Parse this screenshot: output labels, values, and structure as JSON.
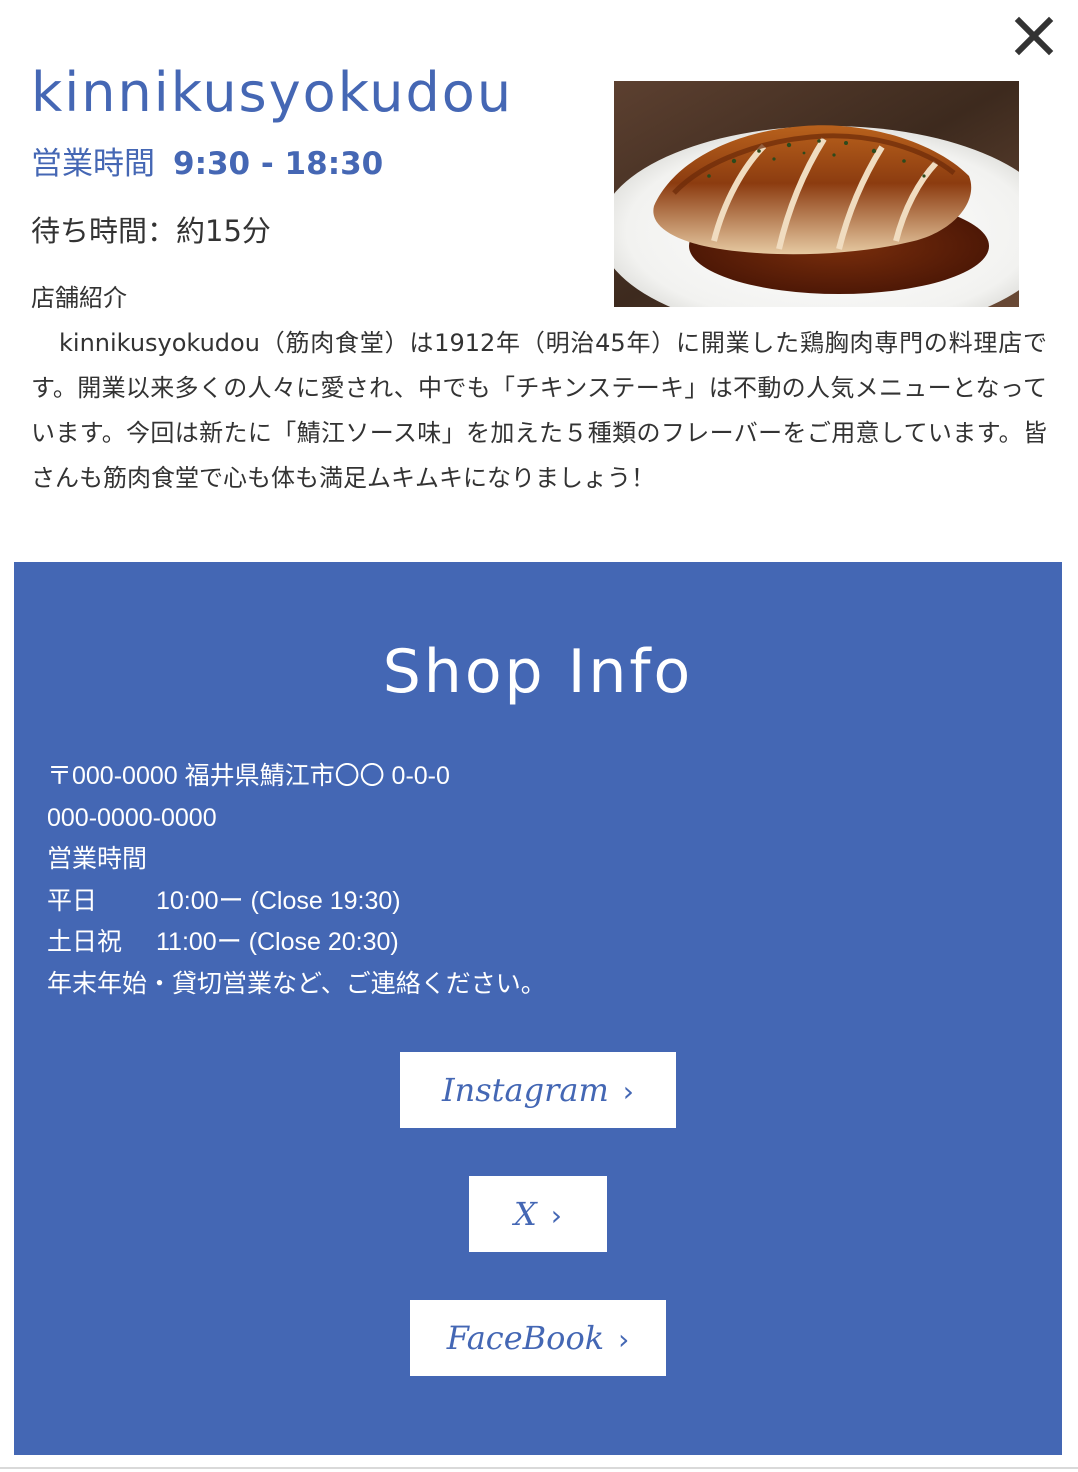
{
  "modal": {
    "close_icon": "close-icon"
  },
  "shop": {
    "name": "kinnikusyokudou",
    "hours_label": "営業時間",
    "hours_value": "9:30 - 18:30",
    "wait_time": "待ち時間：約15分",
    "intro_heading": "店舗紹介",
    "intro_text": "kinnikusyokudou（筋肉食堂）は1912年（明治45年）に開業した鶏胸肉専門の料理店です。開業以来多くの人々に愛され、中でも「チキンステーキ」は不動の人気メニューとなっています。今回は新たに「鯖江ソース味」を加えた５種類のフレーバーをご用意しています。皆さんも筋肉食堂で心も体も満足ムキムキになりましょう！"
  },
  "shop_info": {
    "title": "Shop Info",
    "address": "〒000-0000 福井県鯖江市〇〇 0-0-0",
    "phone": "000-0000-0000",
    "hours_heading": "営業時間",
    "weekday_label": "平日",
    "weekday_hours": "10:00ー  (Close 19:30)",
    "holiday_label": "土日祝",
    "holiday_hours": "11:00ー  (Close 20:30)",
    "note": "年末年始・貸切営業など、ご連絡ください。"
  },
  "sns": {
    "instagram": "Instagram",
    "x": "X",
    "facebook": "FaceBook",
    "chevron": "›"
  },
  "colors": {
    "accent": "#4467b4",
    "text": "#333333",
    "background": "#ffffff"
  }
}
